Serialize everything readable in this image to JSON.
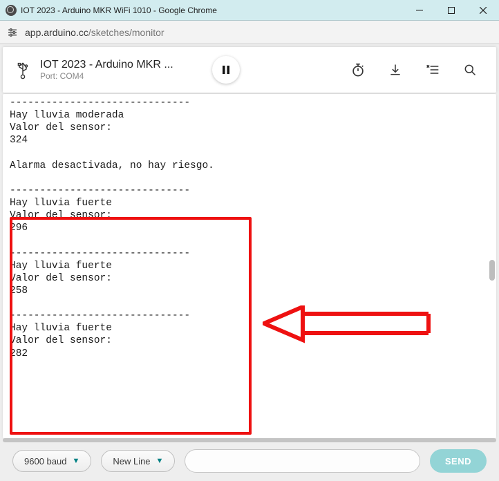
{
  "window": {
    "title": "IOT 2023 - Arduino MKR WiFi 1010 - Google Chrome"
  },
  "browser": {
    "url_host": "app.arduino.cc",
    "url_path": "/sketches/monitor"
  },
  "toolbar": {
    "sketch_title": "IOT 2023 - Arduino MKR ...",
    "port_label": "Port: COM4"
  },
  "bottom": {
    "baud": "9600 baud",
    "line_ending": "New Line",
    "send_label": "SEND",
    "input_value": ""
  },
  "console_text": "------------------------------\nHay lluvia moderada\nValor del sensor:\n324\n\nAlarma desactivada, no hay riesgo.\n\n------------------------------\nHay lluvia fuerte\nValor del sensor:\n296\n\n------------------------------\nHay lluvia fuerte\nValor del sensor:\n258\n\n------------------------------\nHay lluvia fuerte\nValor del sensor:\n282"
}
